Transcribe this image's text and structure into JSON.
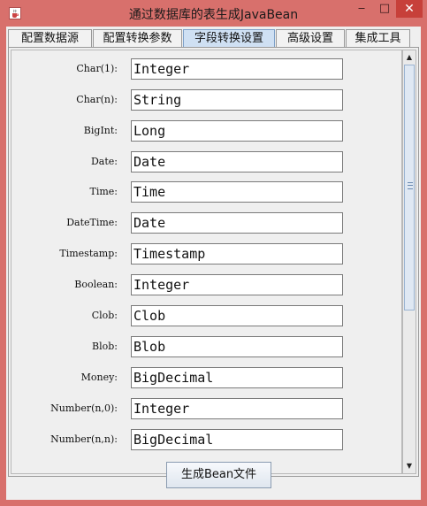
{
  "window": {
    "title": "通过数据库的表生成JavaBean",
    "controls": {
      "minimize": "‒",
      "maximize": "□",
      "close": "✕"
    }
  },
  "tabs": [
    {
      "label": "配置数据源",
      "active": false
    },
    {
      "label": "配置转换参数",
      "active": false
    },
    {
      "label": "字段转换设置",
      "active": true
    },
    {
      "label": "高级设置",
      "active": false
    },
    {
      "label": "集成工具",
      "active": false
    }
  ],
  "mappings": [
    {
      "label": "Char(1):",
      "value": "Integer"
    },
    {
      "label": "Char(n):",
      "value": "String"
    },
    {
      "label": "BigInt:",
      "value": "Long"
    },
    {
      "label": "Date:",
      "value": "Date"
    },
    {
      "label": "Time:",
      "value": "Time"
    },
    {
      "label": "DateTime:",
      "value": "Date"
    },
    {
      "label": "Timestamp:",
      "value": "Timestamp"
    },
    {
      "label": "Boolean:",
      "value": "Integer"
    },
    {
      "label": "Clob:",
      "value": "Clob"
    },
    {
      "label": "Blob:",
      "value": "Blob"
    },
    {
      "label": "Money:",
      "value": "BigDecimal"
    },
    {
      "label": "Number(n,0):",
      "value": "Integer"
    },
    {
      "label": "Number(n,n):",
      "value": "BigDecimal"
    }
  ],
  "scrollbar": {
    "position": 0.0,
    "visible_fraction": 0.6
  },
  "footer": {
    "generate_button": "生成Bean文件"
  },
  "colors": {
    "title_bar": "#d8706c",
    "close_button": "#c7403a",
    "active_tab": "#cfe0f3"
  }
}
